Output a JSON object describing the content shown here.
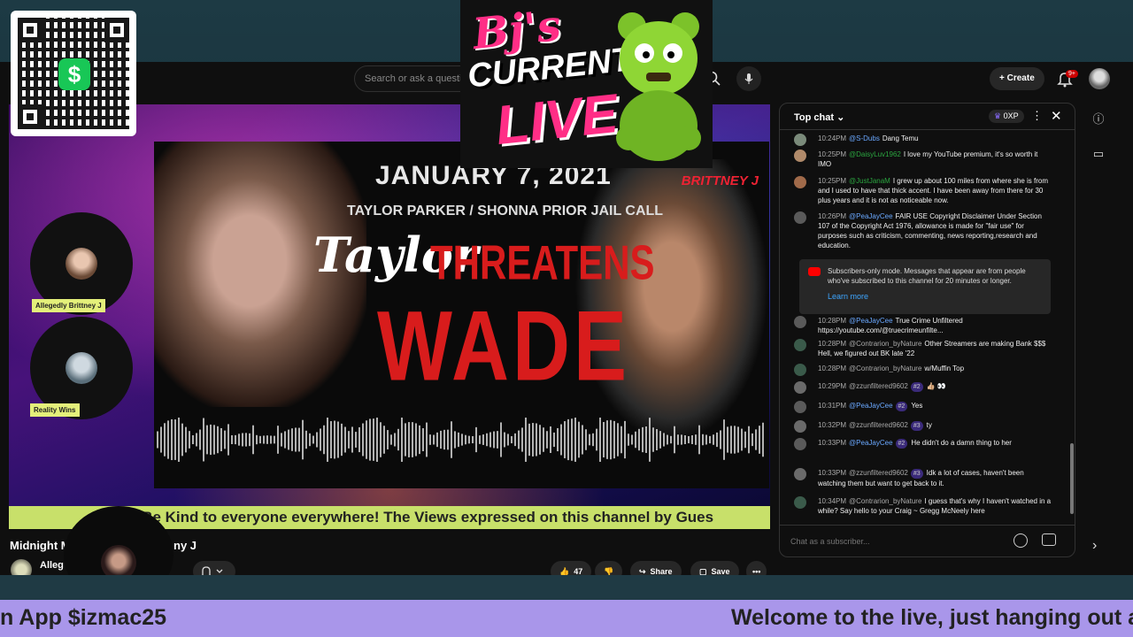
{
  "search": {
    "placeholder": "Search or ask a questi"
  },
  "header": {
    "create_label": "Create",
    "notif_badge": "9+"
  },
  "logo": {
    "line1": "Bj's",
    "line2": "CURRENT",
    "line3": "LIVE"
  },
  "video": {
    "thumb_date": "JANUARY 7, 2021",
    "thumb_sub": "TAYLOR PARKER / SHONNA PRIOR JAIL CALL",
    "thumb_name": "BRITTNEY J",
    "thumb_taylor": "Taylor",
    "thumb_threatens": "THREATENS",
    "thumb_wade": "WADE",
    "ticker": "e Be Kind to everyone everywhere! The Views expressed on this channel by Gues"
  },
  "guests": [
    {
      "label": "Allegedly Brittney J"
    },
    {
      "label": "Reality Wins"
    }
  ],
  "info": {
    "title_left": "Midnight M",
    "title_right": "ny J",
    "channel_name": "Alleg",
    "likes": "47",
    "share_label": "Share",
    "save_label": "Save"
  },
  "host": {
    "tag": "lzmac25"
  },
  "chat": {
    "title": "Top chat",
    "xp": "0XP",
    "messages": [
      {
        "time": "10:24PM",
        "author": "@S-Dubs",
        "text": "Dang Temu"
      },
      {
        "time": "10:25PM",
        "author": "@DaisyLuv1962",
        "text": "I love my YouTube premium, it's so worth it IMO"
      },
      {
        "time": "10:25PM",
        "author": "@JustJanaM",
        "text": "I grew up about 100 miles from where she is from and I used to have that thick accent. I have been away from there for 30 plus years and it is not as noticeable now."
      },
      {
        "time": "10:26PM",
        "author": "@PeaJayCee",
        "text": "FAIR USE Copyright Disclaimer Under Section 107 of the Copyright Act 1976, allowance is made for \"fair use\" for purposes such as criticism, commenting, news reporting,research and education."
      },
      {
        "time": "10:28PM",
        "author": "@PeaJayCee",
        "text": "True Crime Unfiltered https://youtube.com/@truecrimeunfilte..."
      },
      {
        "time": "10:28PM",
        "author": "@Contrarion_byNature",
        "text": "Other Streamers are making Bank $$$ Hell, we figured out BK late '22"
      },
      {
        "time": "10:28PM",
        "author": "@Contrarion_byNature",
        "text": "w/Muffin Top"
      },
      {
        "time": "10:29PM",
        "author": "@zzunfiltered9602",
        "rank": "#2",
        "text": "👍🏼 👀"
      },
      {
        "time": "10:31PM",
        "author": "@PeaJayCee",
        "rank": "#2",
        "text": "Yes"
      },
      {
        "time": "10:32PM",
        "author": "@zzunfiltered9602",
        "rank": "#3",
        "text": "ty"
      },
      {
        "time": "10:33PM",
        "author": "@PeaJayCee",
        "rank": "#2",
        "text": "He didn't do a damn thing to her"
      },
      {
        "time": "10:33PM",
        "author": "@zzunfiltered9602",
        "rank": "#3",
        "text": "Idk a lot of cases, haven't been watching them but want to get back to it."
      },
      {
        "time": "10:34PM",
        "author": "@Contrarion_byNature",
        "text": "I guess that's why I haven't watched in a while? Say hello to your Craig ~ Gregg McNeely here"
      }
    ],
    "notice_text": "Subscribers-only mode. Messages that appear are from people who've subscribed to this channel for 20 minutes or longer.",
    "notice_link": "Learn more",
    "input_placeholder": "Chat as a subscriber..."
  },
  "bottom_ticker": {
    "left": "n App $izmac25",
    "right": "Welcome to the live, just hanging out a"
  },
  "colors": {
    "ticker_yellow": "#c8e06a",
    "ticker_purple": "#a996ea",
    "accent_pink": "#ff2e86",
    "thumb_red": "#d81c1c"
  }
}
